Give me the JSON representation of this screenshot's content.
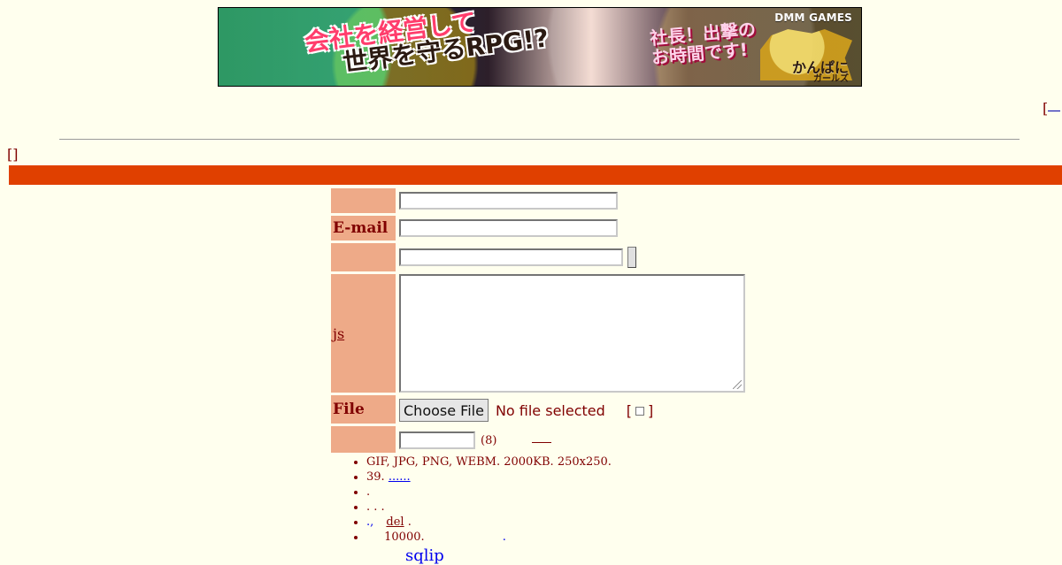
{
  "banner": {
    "brand": "DMM GAMES",
    "headline_1": "会社を経営して",
    "headline_2": "世界を守るRPG!?",
    "cta_1": "社長！出撃の",
    "cta_2": "お時間です!",
    "game_title": "かんぱに",
    "game_subtitle": "ガールズ"
  },
  "top": {
    "right_bracket": "["
  },
  "mini": {
    "brackets": "[]"
  },
  "form": {
    "rows": [
      {
        "label": "",
        "input_value": ""
      },
      {
        "label": "E-mail",
        "input_value": ""
      },
      {
        "label": "",
        "input_value": ""
      },
      {
        "label": "js",
        "textarea_value": ""
      },
      {
        "label": "File",
        "button_label": "Choose File",
        "file_status": "No file selected",
        "bracket_left": "[",
        "bracket_right": "]"
      },
      {
        "label": "",
        "password_value": "",
        "hint": "(8)"
      }
    ]
  },
  "notes": {
    "items": [
      {
        "text": "GIF, JPG, PNG, WEBM. 2000KB. 250x250."
      },
      {
        "text": "39.",
        "link": "......"
      },
      {
        "text": "."
      },
      {
        "text": ". . ."
      },
      {
        "text_prefix": ".,",
        "del": "del",
        "text_suffix": "."
      },
      {
        "text_prefix": "",
        "text_suffix": "10000.",
        "tail": "."
      }
    ]
  },
  "footer": {
    "sqlip": "sqlip"
  }
}
